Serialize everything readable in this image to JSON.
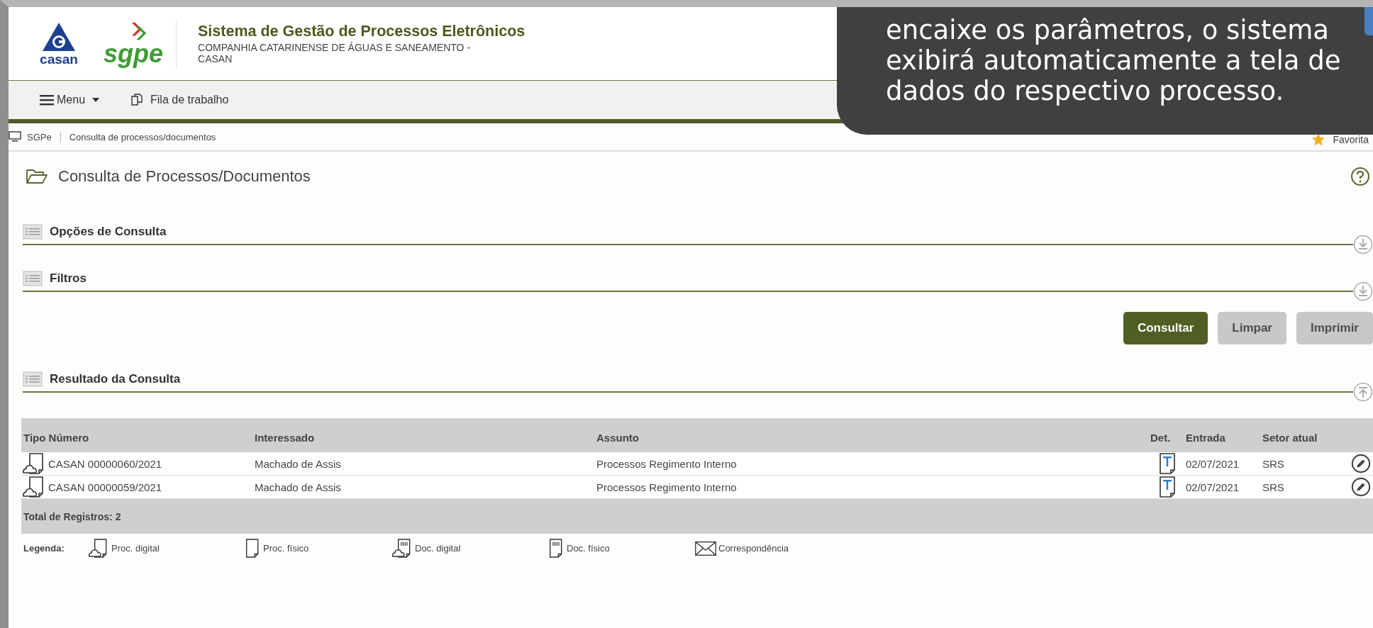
{
  "header": {
    "logo_text": "casan",
    "brand": "sgpe",
    "title": "Sistema de Gestão de Processos Eletrônicos",
    "subtitle": "COMPANHIA CATARINENSE DE ÁGUAS E SANEAMENTO - CASAN"
  },
  "menu_bar": {
    "items": [
      {
        "kind": "menu",
        "label": "Menu"
      },
      {
        "kind": "queue",
        "label": "Fila de trabalho"
      }
    ]
  },
  "breadcrumb": {
    "items": [
      "SGPe",
      "Consulta de processos/documentos"
    ],
    "favorite": "Favorita"
  },
  "page_title": "Consulta de Processos/Documentos",
  "sections": [
    {
      "title": "Opções de Consulta",
      "expanded": false
    },
    {
      "title": "Filtros",
      "expanded": false
    }
  ],
  "buttons": [
    {
      "label": "Consultar",
      "kind": "primary"
    },
    {
      "label": "Limpar",
      "kind": "secondary"
    },
    {
      "label": "Imprimir",
      "kind": "secondary"
    }
  ],
  "results": {
    "title": "Resultado da Consulta",
    "expanded": true,
    "columns": [
      "Tipo Número",
      "Interessado",
      "Assunto",
      "Det.",
      "Entrada",
      "Setor atual"
    ],
    "rows": [
      {
        "kind": "proc_digital",
        "number": "CASAN 00000060/2021",
        "interested": "Machado de Assis",
        "subject": "Processos Regimento Interno",
        "entry": "02/07/2021",
        "sector": "SRS"
      },
      {
        "kind": "proc_digital",
        "number": "CASAN 00000059/2021",
        "interested": "Machado de Assis",
        "subject": "Processos Regimento Interno",
        "entry": "02/07/2021",
        "sector": "SRS"
      }
    ],
    "total": "Total de Registros: 2",
    "legend_label": "Legenda:",
    "legend": [
      {
        "kind": "proc_digital",
        "label": "Proc. digital"
      },
      {
        "kind": "proc_fisico",
        "label": "Proc. físico"
      },
      {
        "kind": "doc_digital",
        "label": "Doc. digital"
      },
      {
        "kind": "doc_fisico",
        "label": "Doc. físico"
      },
      {
        "kind": "correspondencia",
        "label": "Correspondência"
      }
    ]
  },
  "tooltip": {
    "text": "encaixe os parâmetros, o sistema exibirá automaticamente a tela de dados do respectivo processo."
  }
}
